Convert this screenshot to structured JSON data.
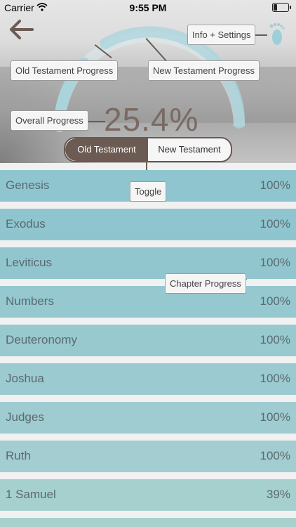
{
  "status": {
    "carrier": "Carrier",
    "time": "9:55 PM"
  },
  "nav": {
    "back_icon": "arrow-left-icon",
    "info_icon": "footprints-icon"
  },
  "callouts": {
    "info_settings": "Info + Settings",
    "old_progress": "Old Testament Progress",
    "new_progress": "New Testament Progress",
    "overall": "Overall Progress",
    "toggle": "Toggle",
    "chapter": "Chapter Progress"
  },
  "overall_percent": "25.4%",
  "toggle": {
    "left": "Old Testament",
    "right": "New Testament",
    "selected": "Old Testament"
  },
  "colors": {
    "accent": "#6b5b52",
    "row": "#8fc5cf",
    "arc": "#a9d4dc"
  },
  "books": [
    {
      "name": "Genesis",
      "percent": "100%",
      "progress": 1.0
    },
    {
      "name": "Exodus",
      "percent": "100%",
      "progress": 1.0
    },
    {
      "name": "Leviticus",
      "percent": "100%",
      "progress": 1.0
    },
    {
      "name": "Numbers",
      "percent": "100%",
      "progress": 1.0
    },
    {
      "name": "Deuteronomy",
      "percent": "100%",
      "progress": 1.0
    },
    {
      "name": "Joshua",
      "percent": "100%",
      "progress": 1.0
    },
    {
      "name": "Judges",
      "percent": "100%",
      "progress": 1.0
    },
    {
      "name": "Ruth",
      "percent": "100%",
      "progress": 1.0
    },
    {
      "name": "1 Samuel",
      "percent": "39%",
      "progress": 0.39
    }
  ]
}
